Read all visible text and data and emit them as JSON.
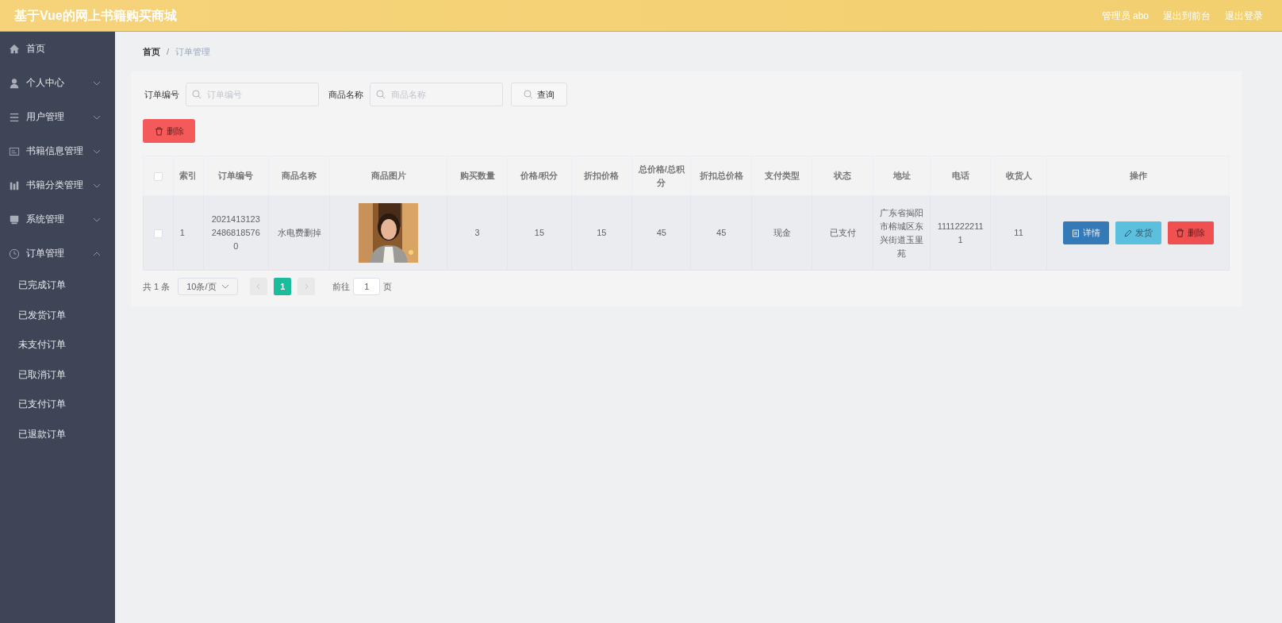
{
  "header": {
    "title": "基于Vue的网上书籍购买商城",
    "links": [
      "管理员 abo",
      "退出到前台",
      "退出登录"
    ]
  },
  "sidebar": {
    "items": [
      {
        "label": "首页"
      },
      {
        "label": "个人中心",
        "expanded": false
      },
      {
        "label": "用户管理",
        "expanded": false
      },
      {
        "label": "书籍信息管理",
        "expanded": false
      },
      {
        "label": "书籍分类管理",
        "expanded": false
      },
      {
        "label": "系统管理",
        "expanded": false
      },
      {
        "label": "订单管理",
        "expanded": true,
        "children": [
          {
            "label": "已完成订单"
          },
          {
            "label": "已发货订单"
          },
          {
            "label": "未支付订单"
          },
          {
            "label": "已取消订单"
          },
          {
            "label": "已支付订单"
          },
          {
            "label": "已退款订单"
          }
        ]
      }
    ]
  },
  "breadcrumb": {
    "items": [
      "首页",
      "订单管理"
    ],
    "separator": "/"
  },
  "search": {
    "fields": [
      {
        "label": "订单编号",
        "placeholder": "订单编号"
      },
      {
        "label": "商品名称",
        "placeholder": "商品名称"
      }
    ],
    "button": "查询"
  },
  "delete_button": "删除",
  "table": {
    "all_checked": false,
    "columns": [
      "索引",
      "订单编号",
      "商品名称",
      "商品图片",
      "购买数量",
      "价格/积分",
      "折扣价格",
      "总价格/总积分",
      "折扣总价格",
      "支付类型",
      "状态",
      "地址",
      "电话",
      "收货人",
      "操作"
    ],
    "rows": [
      {
        "checked": false,
        "cells": [
          "1",
          "202141312324868185760",
          "水电费删掉",
          null,
          "3",
          "15",
          "15",
          "45",
          "45",
          "现金",
          "已支付",
          "广东省揭阳市榕城区东兴街道玉里苑",
          "11112222111",
          "11"
        ],
        "actions": [
          {
            "kind": "detail",
            "label": "详情"
          },
          {
            "kind": "ship",
            "label": "发货"
          },
          {
            "kind": "delete",
            "label": "删除"
          }
        ]
      }
    ]
  },
  "pagination": {
    "total": "共 1 条",
    "page_size": "10条/页",
    "pages": [
      {
        "label": "1",
        "selected": true
      }
    ],
    "goto_label": "前往",
    "goto_value": "1",
    "goto_suffix": "页"
  }
}
